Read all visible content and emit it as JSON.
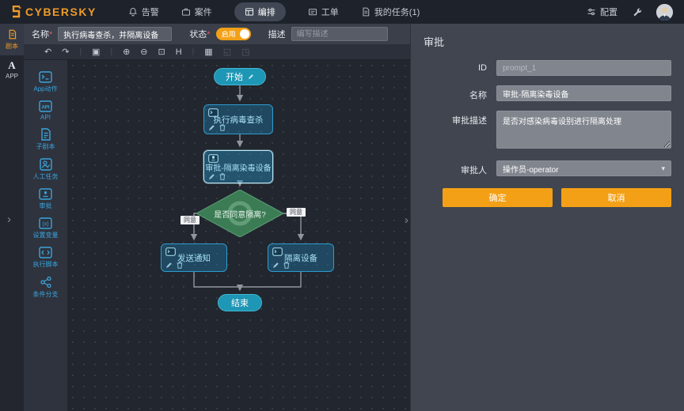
{
  "nav": {
    "brand": "CYBERSKY",
    "items": [
      {
        "label": "告警"
      },
      {
        "label": "案件"
      },
      {
        "label": "编排"
      },
      {
        "label": "工单"
      },
      {
        "label": "我的任务(1)"
      }
    ],
    "config": "配置"
  },
  "rail": {
    "playbook": "剧本",
    "app_glyph": "A",
    "app": "APP"
  },
  "formbar": {
    "name_label": "名称",
    "required_mark": "*",
    "name_value": "执行病毒查杀，并隔离设备",
    "status_label": "状态",
    "status_on": "启用",
    "desc_label": "描述",
    "desc_placeholder": "编写描述"
  },
  "toolbar": {
    "icons": [
      {
        "name": "undo",
        "glyph": "↶"
      },
      {
        "name": "redo",
        "glyph": "↷"
      },
      {
        "name": "clear-canvas",
        "glyph": "▣"
      },
      {
        "name": "zoom-in",
        "glyph": "⊕"
      },
      {
        "name": "zoom-out",
        "glyph": "⊖"
      },
      {
        "name": "fit-view",
        "glyph": "⊡"
      },
      {
        "name": "auto-layout",
        "glyph": "H"
      },
      {
        "name": "snapshot",
        "glyph": "▦"
      },
      {
        "name": "expand",
        "glyph": "◱"
      },
      {
        "name": "fullscreen",
        "glyph": "◳"
      }
    ]
  },
  "palette": {
    "items": [
      {
        "label": "App动作"
      },
      {
        "label": "API"
      },
      {
        "label": "子剧本"
      },
      {
        "label": "人工任务"
      },
      {
        "label": "审批"
      },
      {
        "label": "设置变量"
      },
      {
        "label": "执行脚本"
      },
      {
        "label": "条件分支"
      }
    ]
  },
  "flow": {
    "start": "开始",
    "task_scan": "执行病毒查杀",
    "approval": "审批-隔离染毒设备",
    "decision": "是否同意隔离?",
    "branch_left": "同意",
    "branch_right": "同意",
    "notify": "发送通知",
    "isolate": "隔离设备",
    "end": "结束"
  },
  "panel": {
    "title": "审批",
    "id_label": "ID",
    "id_value": "prompt_1",
    "name_label": "名称",
    "name_value": "审批-隔离染毒设备",
    "desc_label": "审批描述",
    "desc_value": "是否对感染病毒设别进行隔离处理",
    "approver_label": "审批人",
    "approver_value": "操作员-operator",
    "ok": "确定",
    "cancel": "取消"
  },
  "icons": {
    "chevron_down": "▾",
    "collapse_right": "›"
  },
  "colors": {
    "accent_orange": "#f3a017",
    "brand_orange": "#ef9b28",
    "node_blue_border": "#2d9ccf",
    "node_teal": "#1e96b5",
    "diamond_green": "#3c7c55",
    "palette_blue": "#3aa4dc"
  }
}
